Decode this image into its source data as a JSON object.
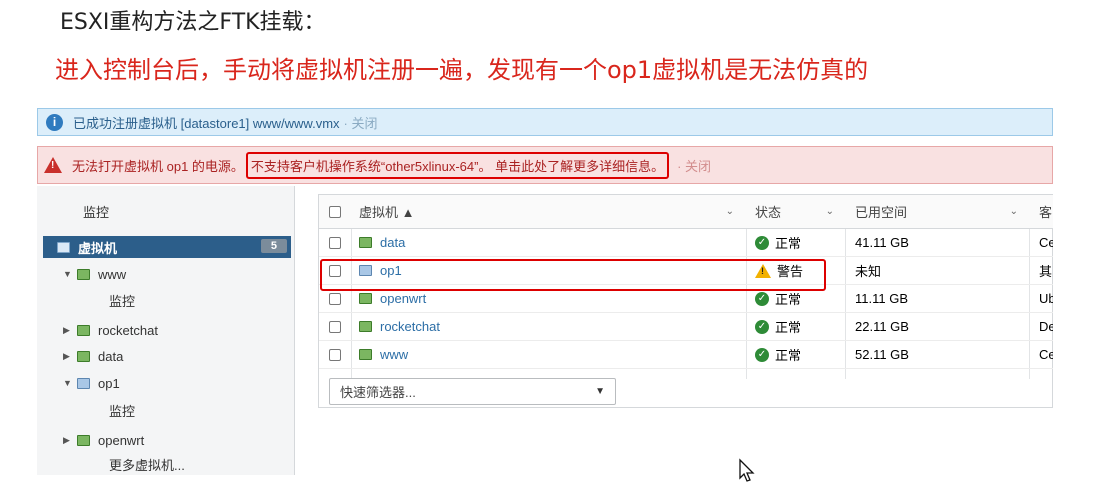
{
  "slide": {
    "title": "ESXI重构方法之FTK挂载：",
    "subtitle": "进入控制台后，手动将虚拟机注册一遍，发现有一个op1虚拟机是无法仿真的"
  },
  "info_banner": {
    "text": "已成功注册虚拟机 [datastore1] www/www.vmx",
    "close": "· 关闭"
  },
  "error_banner": {
    "prefix": "无法打开虚拟机 op1 的电源。",
    "highlight": "不支持客户机操作系统“other5xlinux-64”。 单击此处了解更多详细信息。",
    "close": "· 关闭"
  },
  "sidebar": {
    "monitor_label": "监控",
    "vm_header": "虚拟机",
    "vm_count": "5",
    "items": [
      {
        "label": "www",
        "expanded": true
      },
      {
        "label": "监控"
      },
      {
        "label": "rocketchat",
        "expanded": false
      },
      {
        "label": "data",
        "expanded": false
      },
      {
        "label": "op1",
        "expanded": true
      },
      {
        "label": "监控"
      },
      {
        "label": "openwrt",
        "expanded": false
      },
      {
        "label": "更多虚拟机..."
      }
    ]
  },
  "table": {
    "headers": [
      "虚拟机 ▲",
      "状态",
      "已用空间",
      "客"
    ],
    "rows": [
      {
        "name": "data",
        "status": "正常",
        "status_type": "ok",
        "used": "41.11 GB",
        "guest": "Ce"
      },
      {
        "name": "op1",
        "status": "警告",
        "status_type": "warning",
        "used": "未知",
        "guest": "其"
      },
      {
        "name": "openwrt",
        "status": "正常",
        "status_type": "ok",
        "used": "11.11 GB",
        "guest": "Ub"
      },
      {
        "name": "rocketchat",
        "status": "正常",
        "status_type": "ok",
        "used": "22.11 GB",
        "guest": "De"
      },
      {
        "name": "www",
        "status": "正常",
        "status_type": "ok",
        "used": "52.11 GB",
        "guest": "Ce"
      }
    ]
  },
  "filter": {
    "placeholder": "快速筛选器..."
  },
  "colors": {
    "accent": "#2c5e8a",
    "error": "#d9261c",
    "ok": "#2e8b37",
    "warning": "#f2b100"
  }
}
